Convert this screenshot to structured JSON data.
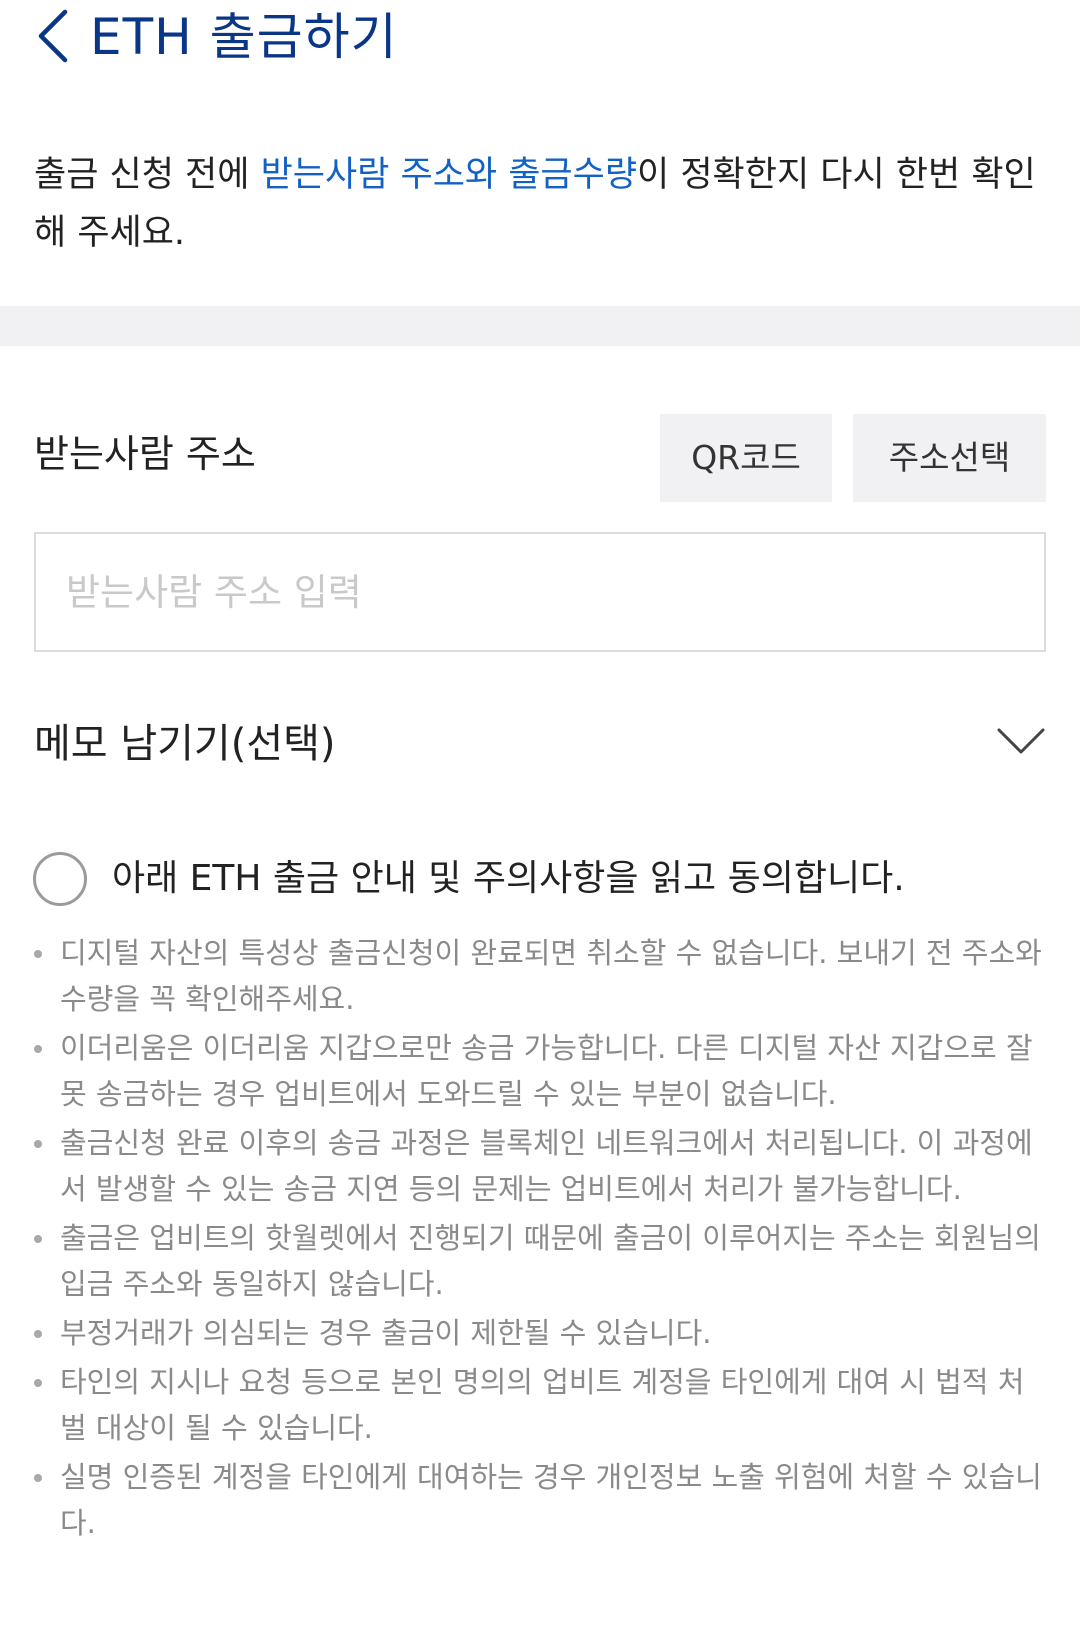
{
  "header": {
    "title": "ETH 출금하기",
    "back_icon": "chevron-left-icon",
    "accent_color": "#093687"
  },
  "notice": {
    "prefix": "출금 신청 전에 ",
    "highlight": "받는사람 주소와 출금수량",
    "suffix": "이 정확한지 다시 한번 확인해 주세요.",
    "highlight_color": "#1261c4"
  },
  "address": {
    "label": "받는사람 주소",
    "qr_button": "QR코드",
    "select_button": "주소선택",
    "input_value": "",
    "input_placeholder": "받는사람 주소 입력"
  },
  "memo": {
    "label": "메모 남기기(선택)",
    "icon": "chevron-down-icon"
  },
  "agreement": {
    "label": "아래 ETH 출금 안내 및 주의사항을 읽고 동의합니다.",
    "checked": false
  },
  "notes": [
    "디지털 자산의 특성상 출금신청이 완료되면 취소할 수 없습니다. 보내기 전 주소와 수량을 꼭 확인해주세요.",
    "이더리움은 이더리움 지갑으로만 송금 가능합니다. 다른 디지털 자산 지갑으로 잘못 송금하는 경우 업비트에서 도와드릴 수 있는 부분이 없습니다.",
    "출금신청 완료 이후의 송금 과정은 블록체인 네트워크에서 처리됩니다. 이 과정에서 발생할 수 있는 송금 지연 등의 문제는 업비트에서 처리가 불가능합니다.",
    "출금은 업비트의 핫월렛에서 진행되기 때문에 출금이 이루어지는 주소는 회원님의 입금 주소와 동일하지 않습니다.",
    "부정거래가 의심되는 경우 출금이 제한될 수 있습니다.",
    "타인의 지시나 요청 등으로 본인 명의의 업비트 계정을 타인에게 대여 시 법적 처벌 대상이 될 수 있습니다.",
    "실명 인증된 계정을 타인에게 대여하는 경우 개인정보 노출 위험에 처할 수 있습니다."
  ]
}
